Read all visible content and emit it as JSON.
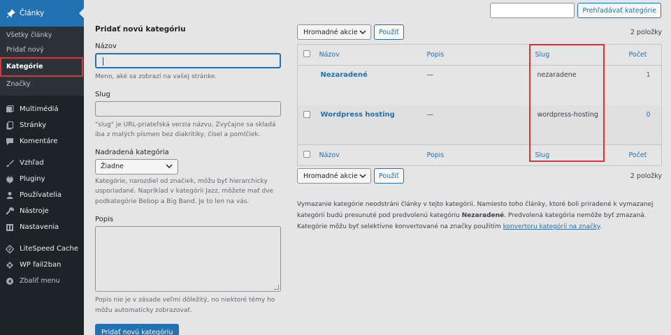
{
  "sidebar": {
    "parent_label": "Články",
    "submenu": [
      "Všetky články",
      "Pridať nový",
      "Kategórie",
      "Značky"
    ],
    "items": [
      "Multimédiá",
      "Stránky",
      "Komentáre",
      "Vzhľad",
      "Pluginy",
      "Používatelia",
      "Nástroje",
      "Nastavenia",
      "LiteSpeed Cache",
      "WP fail2ban",
      "Zbaliť menu"
    ]
  },
  "search": {
    "button_label": "Prehľadávať kategórie",
    "value": ""
  },
  "form": {
    "title": "Pridať novú kategóriu",
    "name_label": "Názov",
    "name_help": "Meno, aké sa zobrazí na vašej stránke.",
    "slug_label": "Slug",
    "slug_help": "\"slug\" je URL-priateľská verzia názvu. Zvyčajne sa skladá iba z malých písmen bez diakritiky, čísel a pomlčiek.",
    "parent_label": "Nadradená kategória",
    "parent_value": "Žiadne",
    "parent_help": "Kategórie, narozdiel od značiek, môžu byť hierarchicky usporiadané. Napríklad v kategórii Jazz, môžete mať dve podkategórie Bebop a Big Band. Je to len na vás.",
    "desc_label": "Popis",
    "desc_help": "Popis nie je v zásade veľmi dôležitý, no niektoré témy ho môžu automaticky zobrazovať.",
    "submit_label": "Pridať novú kategóriu"
  },
  "table": {
    "bulk_label": "Hromadné akcie",
    "apply_label": "Použiť",
    "count": "2 položky",
    "columns": {
      "name": "Názov",
      "desc": "Popis",
      "slug": "Slug",
      "count": "Počet"
    },
    "rows": [
      {
        "name": "Nezaradené",
        "desc": "—",
        "slug": "nezaradene",
        "count": "1",
        "has_checkbox": false
      },
      {
        "name": "Wordpress hosting",
        "desc": "—",
        "slug": "wordpress-hosting",
        "count": "0",
        "has_checkbox": true
      }
    ]
  },
  "notes": {
    "line1_a": "Vymazanie kategórie neodstráni články v tejto kategórii. Namiesto toho články, ktoré boli priradené k vymazanej kategórii budú presunuté pod predvolenú kategóriu ",
    "line1_bold": "Nezaradené",
    "line1_b": ". Predvolená kategória nemôže byť zmazaná.",
    "line2_a": "Kategórie môžu byť selektívne konvertované na značky použitím ",
    "line2_link": "konvertoru kategórií na značky",
    "line2_b": "."
  },
  "colors": {
    "accent": "#2271b1",
    "sidebar": "#1d2327",
    "highlight": "#d63638"
  }
}
